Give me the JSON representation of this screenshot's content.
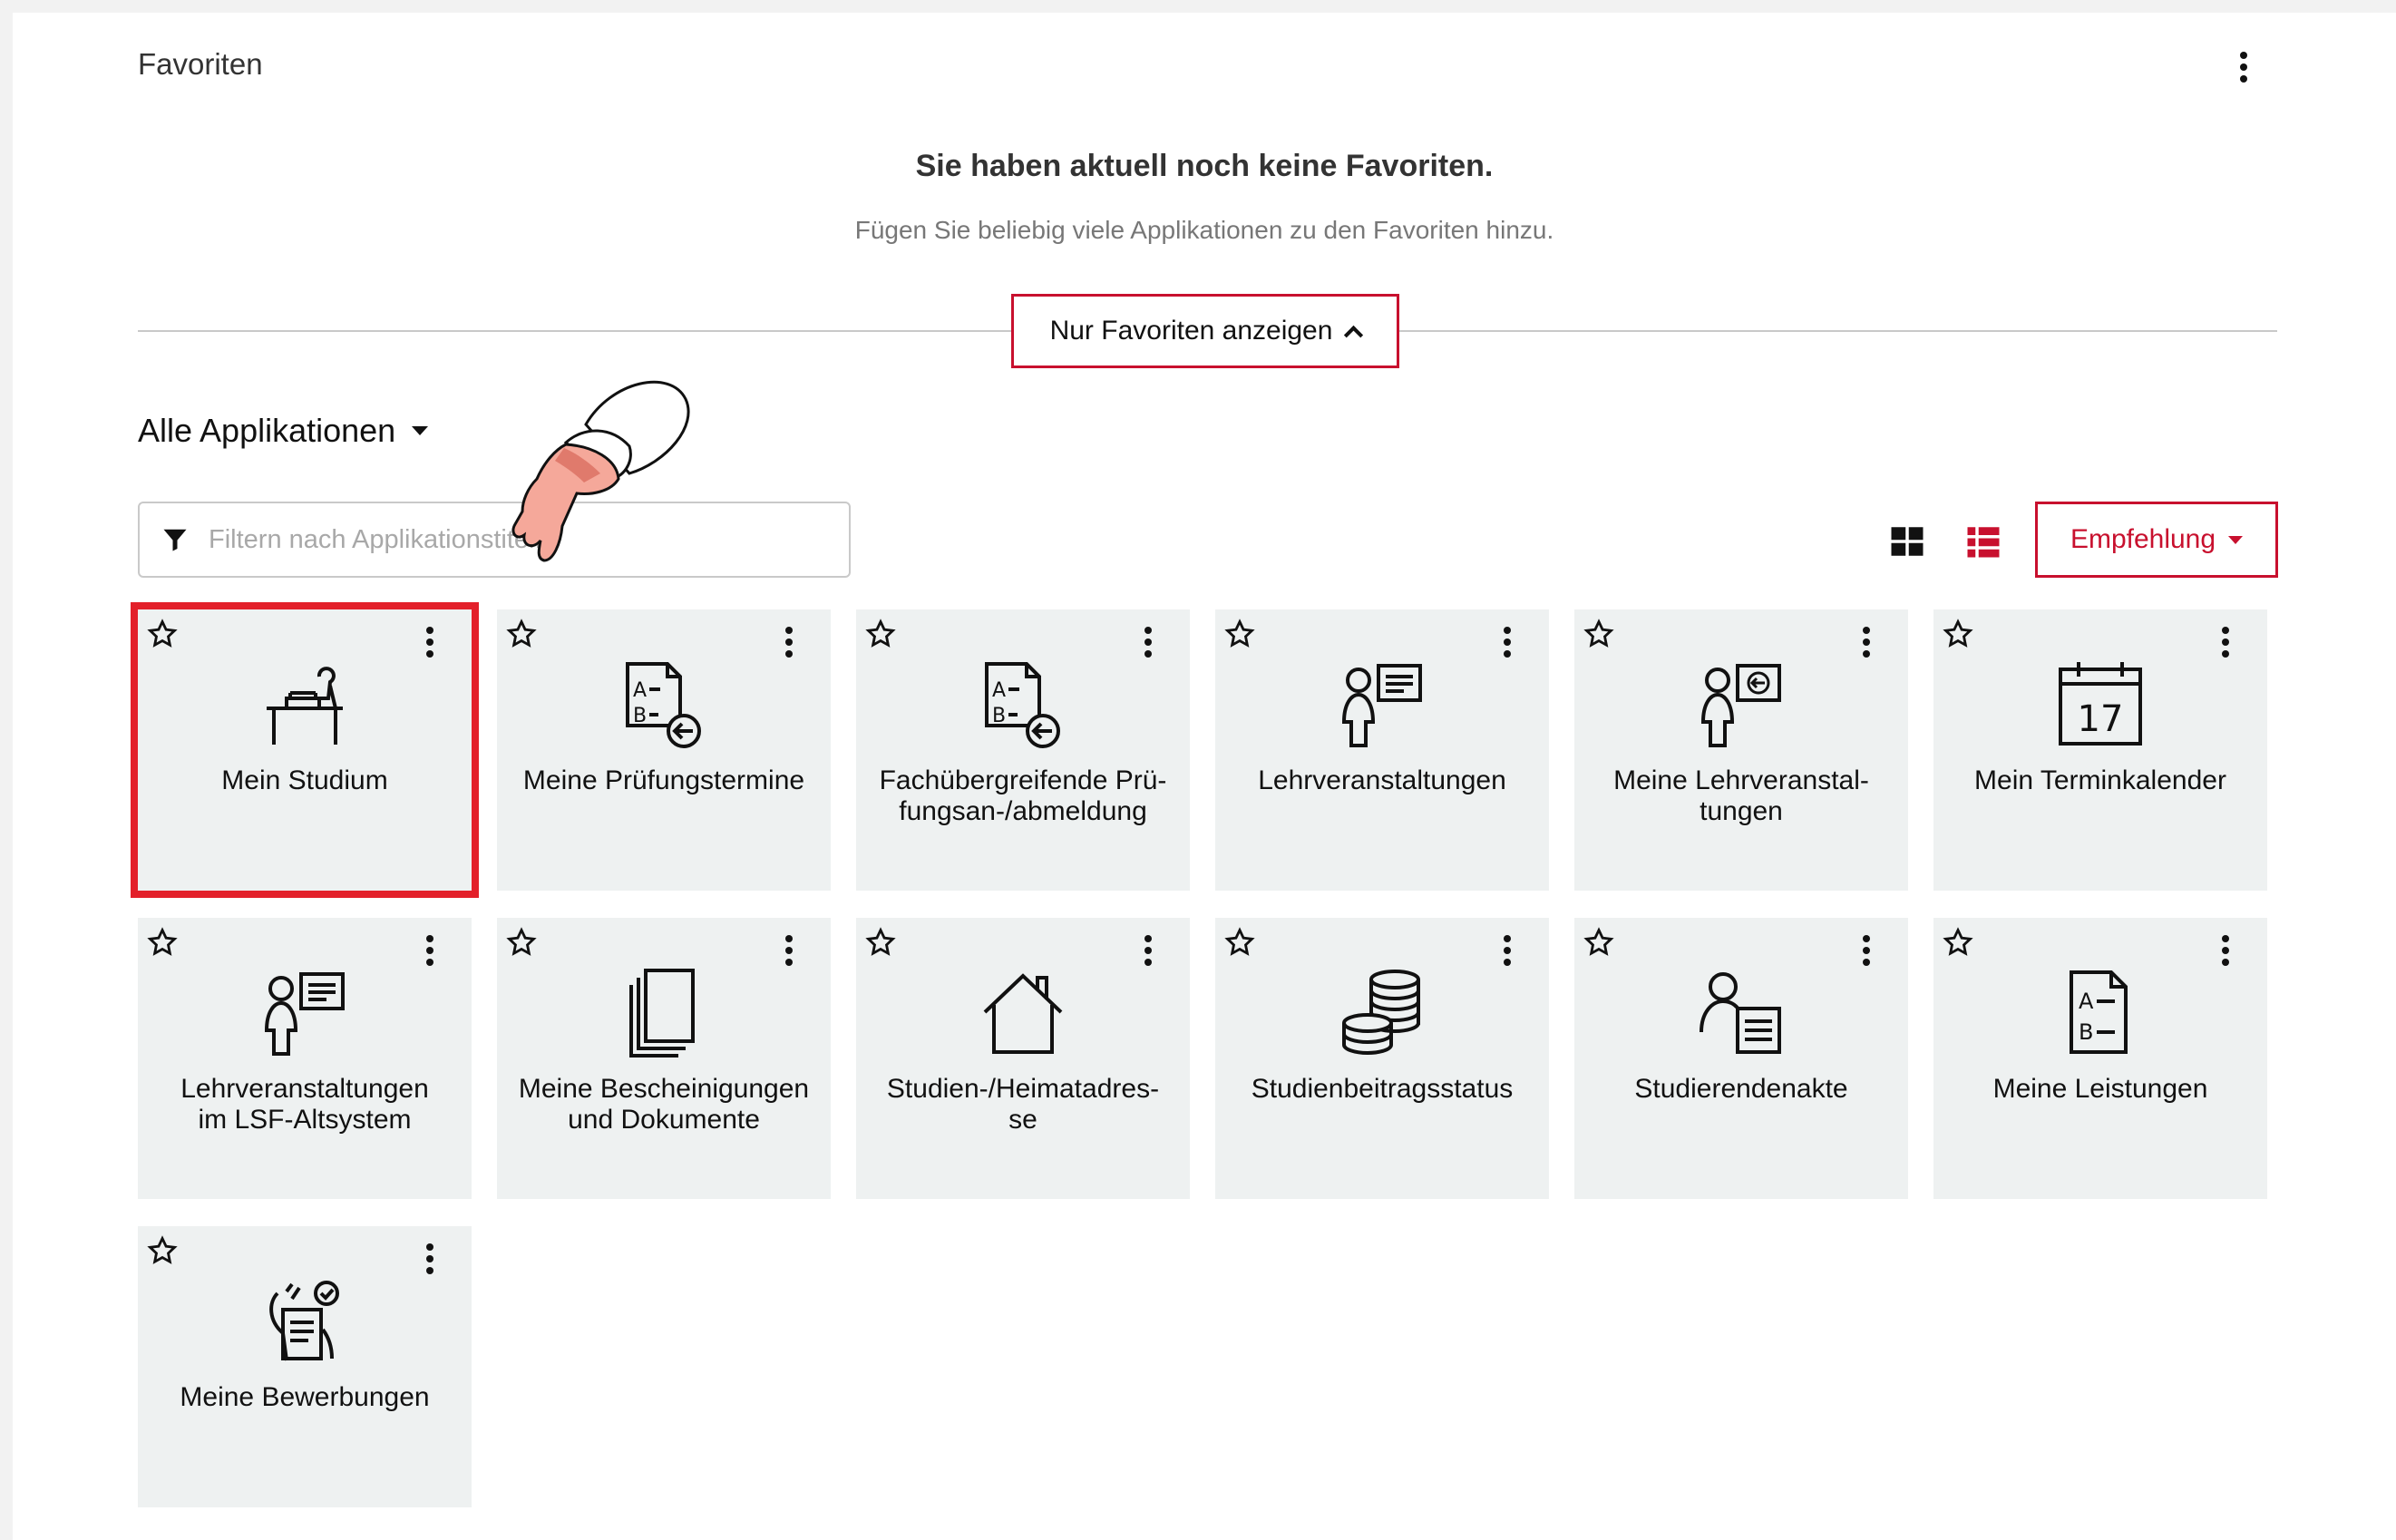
{
  "favorites": {
    "title": "Favoriten",
    "empty_title": "Sie haben aktuell noch keine Favoriten.",
    "empty_subtitle": "Fügen Sie beliebig viele Applikationen zu den Favoriten hinzu.",
    "toggle_label": "Nur Favoriten anzeigen"
  },
  "apps": {
    "dropdown_label": "Alle Applikationen",
    "filter_placeholder": "Filtern nach Applikationstitel...",
    "sort_label": "Empfehlung",
    "active_view": "list"
  },
  "colors": {
    "accent": "#c8102e",
    "tile_bg": "#eef1f1",
    "highlight": "#e3202a"
  },
  "tiles": [
    {
      "label": "Mein Studium",
      "icon": "desk-icon",
      "selected": true
    },
    {
      "label": "Meine Prüfungstermine",
      "icon": "exam-list-icon"
    },
    {
      "label": "Fachübergreifende Prü-\nfungsan-/abmeldung",
      "icon": "exam-register-icon"
    },
    {
      "label": "Lehrveranstaltungen",
      "icon": "lecture-icon"
    },
    {
      "label": "Meine Lehrveranstal-\ntungen",
      "icon": "my-lecture-icon"
    },
    {
      "label": "Mein Terminkalender",
      "icon": "calendar-icon",
      "calendar_day": "17"
    },
    {
      "label": "Lehrveranstaltungen\nim LSF-Altsystem",
      "icon": "lecture-legacy-icon"
    },
    {
      "label": "Meine Bescheinigungen\nund Dokumente",
      "icon": "documents-icon"
    },
    {
      "label": "Studien-/Heimatadres-\nse",
      "icon": "house-icon"
    },
    {
      "label": "Studienbeitragsstatus",
      "icon": "coins-icon"
    },
    {
      "label": "Studierendenakte",
      "icon": "student-file-icon"
    },
    {
      "label": "Meine Leistungen",
      "icon": "grades-icon"
    },
    {
      "label": "Meine Bewerbungen",
      "icon": "application-icon"
    }
  ]
}
